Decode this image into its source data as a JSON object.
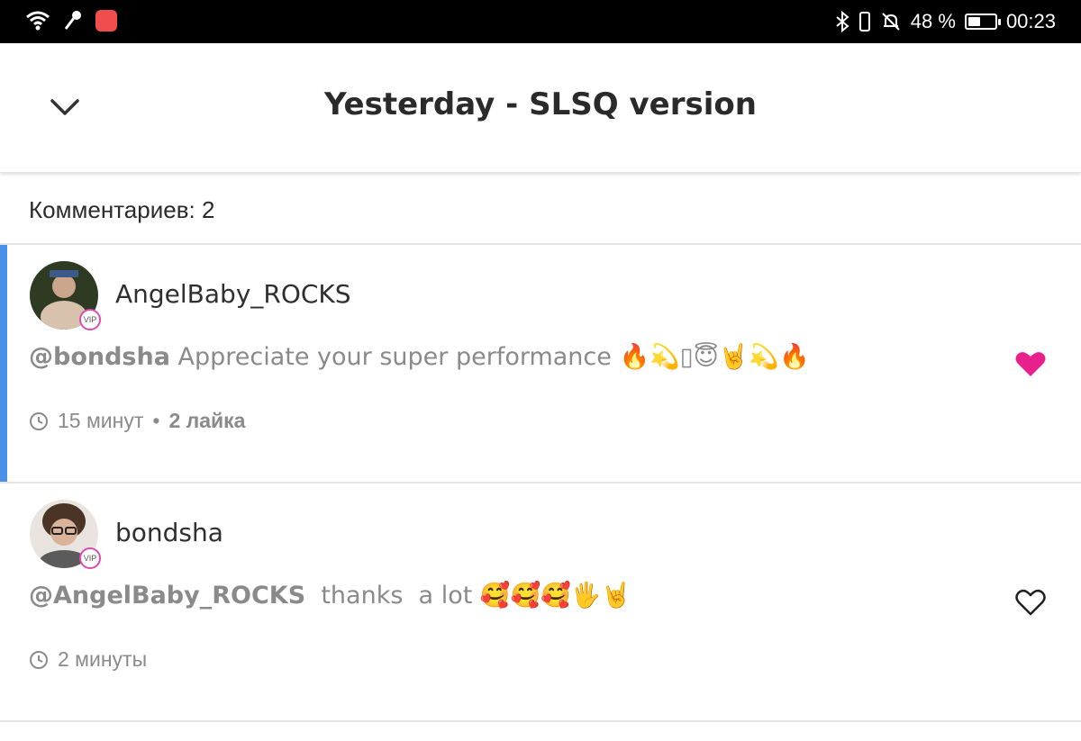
{
  "status_bar": {
    "battery_percent": "48 %",
    "battery_level": 0.48,
    "time": "00:23",
    "icons": [
      "wifi-icon",
      "microphone-icon",
      "app-notification-icon",
      "bluetooth-icon",
      "vibrate-icon",
      "bell-off-icon",
      "battery-icon"
    ]
  },
  "header": {
    "title": "Yesterday - SLSQ version",
    "back_icon": "chevron-down-icon"
  },
  "comments_count_label": "Комментариев: 2",
  "comments": [
    {
      "username": "AngelBaby_ROCKS",
      "vip_badge": "VIP",
      "mention": "@bondsha",
      "text": " Appreciate your super performance ",
      "emojis": "🔥💫▯😇🤘💫🔥",
      "time": "15 минут",
      "separator": "•",
      "likes": "2 лайка",
      "liked": true,
      "like_color": "#e8208c"
    },
    {
      "username": "bondsha",
      "vip_badge": "VIP",
      "mention": "@AngelBaby_ROCKS",
      "text": "  thanks  a lot ",
      "emojis": "🥰🥰🥰🖐🤘",
      "time": "2 минуты",
      "liked": false
    }
  ],
  "colors": {
    "accent": "#4a8fe8",
    "vip_ring": "#d94bb1",
    "status_bar": "#000000"
  }
}
